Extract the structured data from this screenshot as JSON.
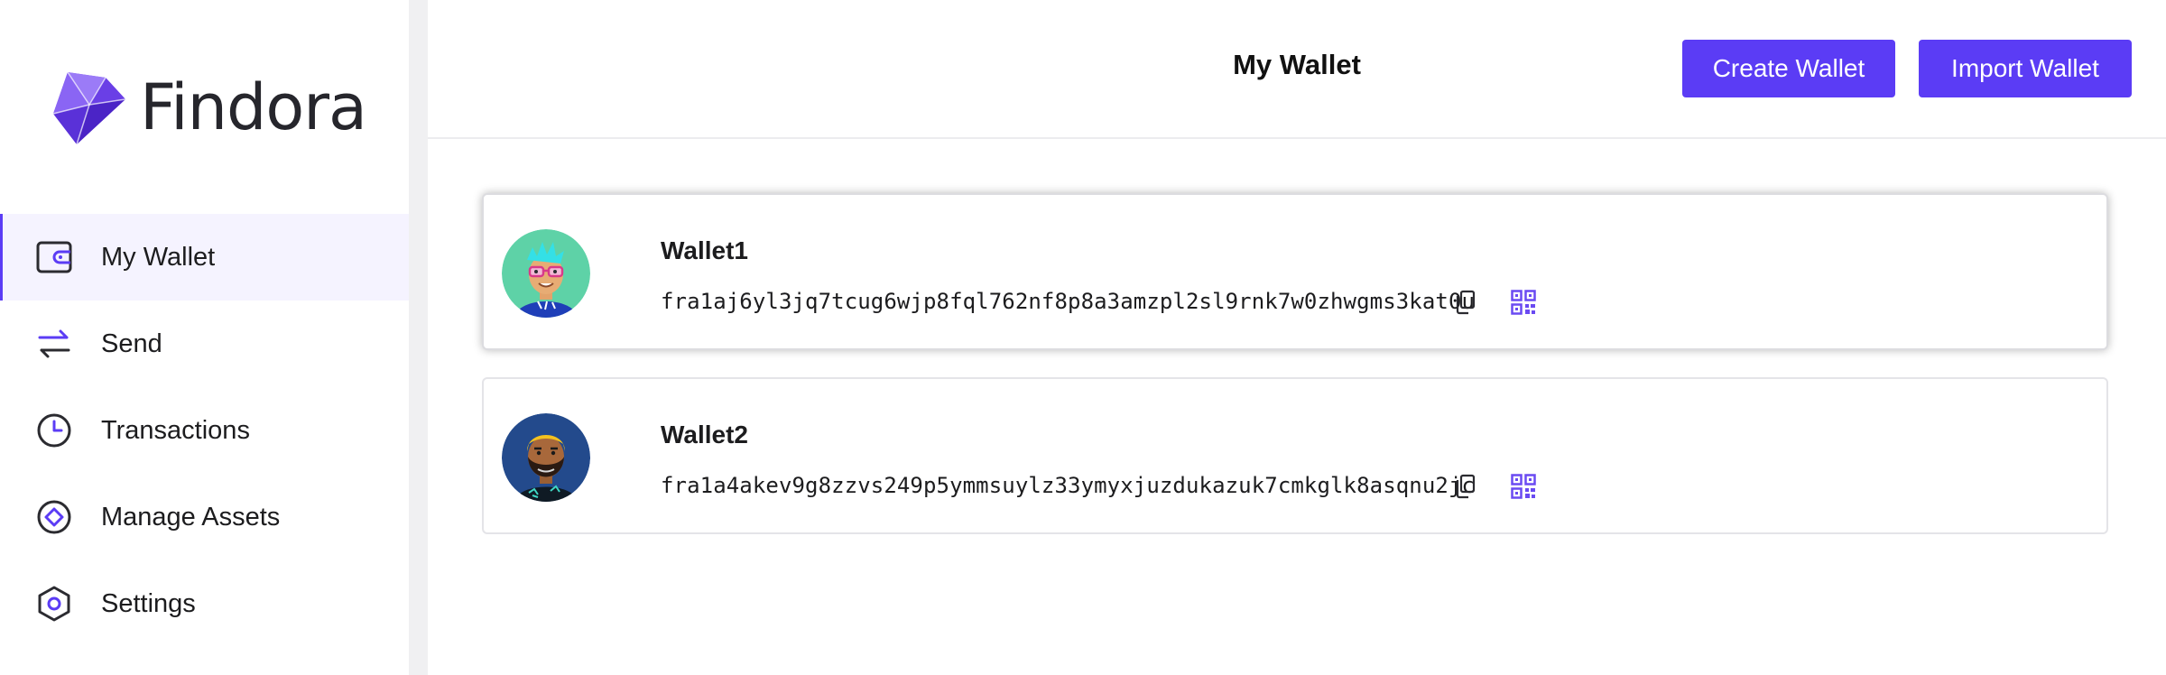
{
  "brand": {
    "name": "Findora",
    "logo_icon": "findora-gem-logo",
    "accent_color": "#5b3cf5"
  },
  "sidebar": {
    "items": [
      {
        "label": "My Wallet",
        "icon": "wallet-icon",
        "active": true
      },
      {
        "label": "Send",
        "icon": "transfer-arrows-icon",
        "active": false
      },
      {
        "label": "Transactions",
        "icon": "clock-icon",
        "active": false
      },
      {
        "label": "Manage Assets",
        "icon": "diamond-circle-icon",
        "active": false
      },
      {
        "label": "Settings",
        "icon": "hexagon-settings-icon",
        "active": false
      }
    ]
  },
  "header": {
    "title": "My Wallet",
    "create_label": "Create Wallet",
    "import_label": "Import Wallet"
  },
  "wallets": [
    {
      "name": "Wallet1",
      "address": "fra1aj6yl3jq7tcug6wjp8fql762nf8p8a3amzpl2sl9rnk7w0zhwgms3kat0u",
      "avatar": "avatar-cyan-hair-glasses",
      "selected": true
    },
    {
      "name": "Wallet2",
      "address": "fra1a4akev9g8zzvs249p5ymmsuylz33ymyxjuzdukazuk7cmkglk8asqnu2jc",
      "avatar": "avatar-bearded-man",
      "selected": false
    }
  ]
}
